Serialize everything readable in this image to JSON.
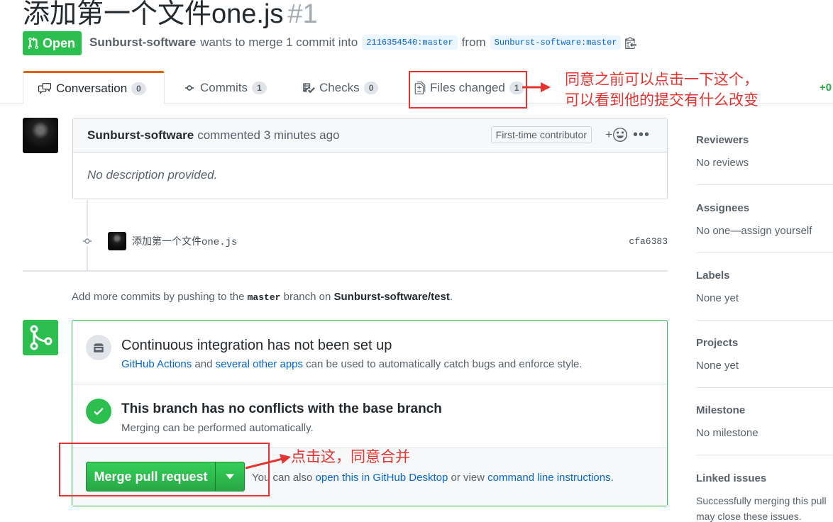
{
  "pr": {
    "title": "添加第一个文件one.js",
    "number": "#1",
    "state": "Open",
    "author": "Sunburst-software",
    "action_text": "wants to merge 1 commit into",
    "base_branch": "2116354540:master",
    "from_text": "from",
    "head_branch": "Sunburst-software:master"
  },
  "tabs": [
    {
      "label": "Conversation",
      "count": "0"
    },
    {
      "label": "Commits",
      "count": "1"
    },
    {
      "label": "Checks",
      "count": "0"
    },
    {
      "label": "Files changed",
      "count": "1"
    }
  ],
  "diffstat": "+0",
  "annotations": {
    "files_note_line1": "同意之前可以点击一下这个，",
    "files_note_line2": "可以看到他的提交有什么改变",
    "merge_note": "点击这，同意合并",
    "color": "#e3342f"
  },
  "comment": {
    "author": "Sunburst-software",
    "time_text": "commented 3 minutes ago",
    "badge": "First-time contributor",
    "body": "No description provided."
  },
  "commit": {
    "message": "添加第一个文件one.js",
    "sha": "cfa6383"
  },
  "hint": {
    "prefix": "Add more commits by pushing to the",
    "branch": "master",
    "middle": "branch on",
    "repo": "Sunburst-software/test",
    "suffix": "."
  },
  "ci": {
    "title": "Continuous integration has not been set up",
    "link1": "GitHub Actions",
    "and": "and",
    "link2": "several other apps",
    "rest": "can be used to automatically catch bugs and enforce style."
  },
  "conflicts": {
    "title": "This branch has no conflicts with the base branch",
    "subtitle": "Merging can be performed automatically."
  },
  "merge": {
    "button": "Merge pull request",
    "also_text": "You can also",
    "link1": "open this in GitHub Desktop",
    "or_view": "or view",
    "link2": "command line instructions",
    "end": "."
  },
  "sidebar": {
    "reviewers": {
      "label": "Reviewers",
      "value": "No reviews"
    },
    "assignees": {
      "label": "Assignees",
      "value": "No one—assign yourself"
    },
    "labels": {
      "label": "Labels",
      "value": "None yet"
    },
    "projects": {
      "label": "Projects",
      "value": "None yet"
    },
    "milestone": {
      "label": "Milestone",
      "value": "No milestone"
    },
    "linked": {
      "label": "Linked issues",
      "value_line1": "Successfully merging this pull",
      "value_line2": "may close these issues."
    }
  },
  "colors": {
    "green": "#2cbe4e",
    "link": "#0366d6",
    "accent_tab": "#e36209"
  }
}
